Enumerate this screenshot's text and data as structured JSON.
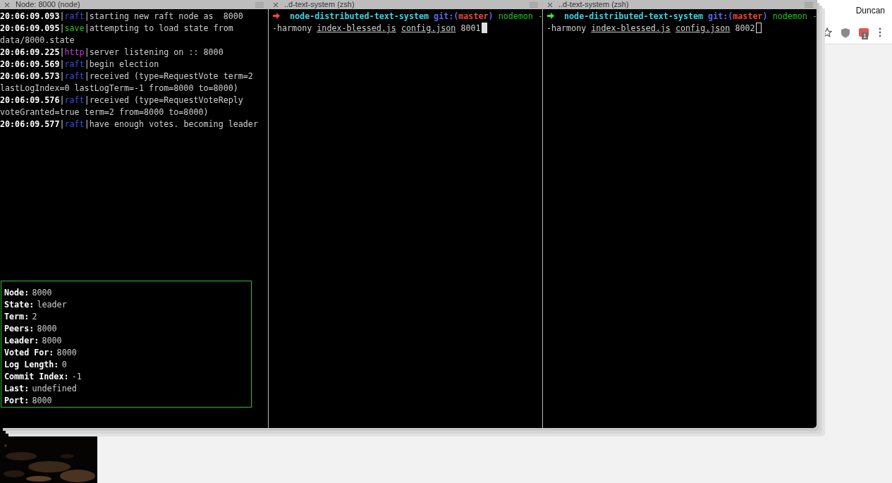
{
  "panes": [
    {
      "title": "Node: 8000 (node)",
      "kind": "log",
      "log": [
        {
          "time": "20:06:09.093",
          "separator": "|",
          "tag": "raft",
          "color": "#3a4fe0",
          "message": "starting new raft node as  8000"
        },
        {
          "time": "20:06:09.095",
          "separator": "|",
          "tag": "save",
          "color": "#25c025",
          "message": "attempting to load state from data/8000.state"
        },
        {
          "time": "20:06:09.225",
          "separator": "|",
          "tag": "http",
          "color": "#c93ad6",
          "message": "server listening on :: 8000"
        },
        {
          "time": "20:06:09.569",
          "separator": "|",
          "tag": "raft",
          "color": "#3a4fe0",
          "message": "begin election"
        },
        {
          "time": "20:06:09.573",
          "separator": "|",
          "tag": "raft",
          "color": "#3a4fe0",
          "message": "received (type=RequestVote term=2 lastLogIndex=0 lastLogTerm=-1 from=8000 to=8000)"
        },
        {
          "time": "20:06:09.576",
          "separator": "|",
          "tag": "raft",
          "color": "#3a4fe0",
          "message": "received (type=RequestVoteReply voteGranted=true term=2 from=8000 to=8000)"
        },
        {
          "time": "20:06:09.577",
          "separator": "|",
          "tag": "raft",
          "color": "#3a4fe0",
          "message": "have enough votes. becoming leader"
        }
      ],
      "status": [
        {
          "label": "Node:",
          "value": "8000"
        },
        {
          "label": "State:",
          "value": "leader"
        },
        {
          "label": "Term:",
          "value": "2"
        },
        {
          "label": "Peers:",
          "value": "8000"
        },
        {
          "label": "Leader:",
          "value": "8000"
        },
        {
          "label": "Voted For:",
          "value": "8000"
        },
        {
          "label": "Log Length:",
          "value": "0"
        },
        {
          "label": "Commit Index:",
          "value": "-1"
        },
        {
          "label": "Last:",
          "value": "undefined"
        },
        {
          "label": "Port:",
          "value": "8000"
        }
      ]
    },
    {
      "title": "..d-text-system (zsh)",
      "kind": "shell",
      "focused": true,
      "prompt": {
        "color": "#ef4a3a",
        "directory": "node-distributed-text-system",
        "git_open": "git:(",
        "branch": "master",
        "git_close": ")",
        "command": "nodemon -",
        "continuation": "-harmony",
        "files": [
          "index-blessed.js",
          "config.json"
        ],
        "port": "8001"
      }
    },
    {
      "title": "..d-text-system (zsh)",
      "kind": "shell",
      "focused": false,
      "prompt": {
        "color": "#3fe03f",
        "directory": "node-distributed-text-system",
        "git_open": "git:(",
        "branch": "master",
        "git_close": ")",
        "command": "nodemon -",
        "continuation": "-harmony",
        "files": [
          "index-blessed.js",
          "config.json"
        ],
        "port": "8002"
      }
    }
  ],
  "browser": {
    "user": "Duncan",
    "extension_badge": "1"
  }
}
